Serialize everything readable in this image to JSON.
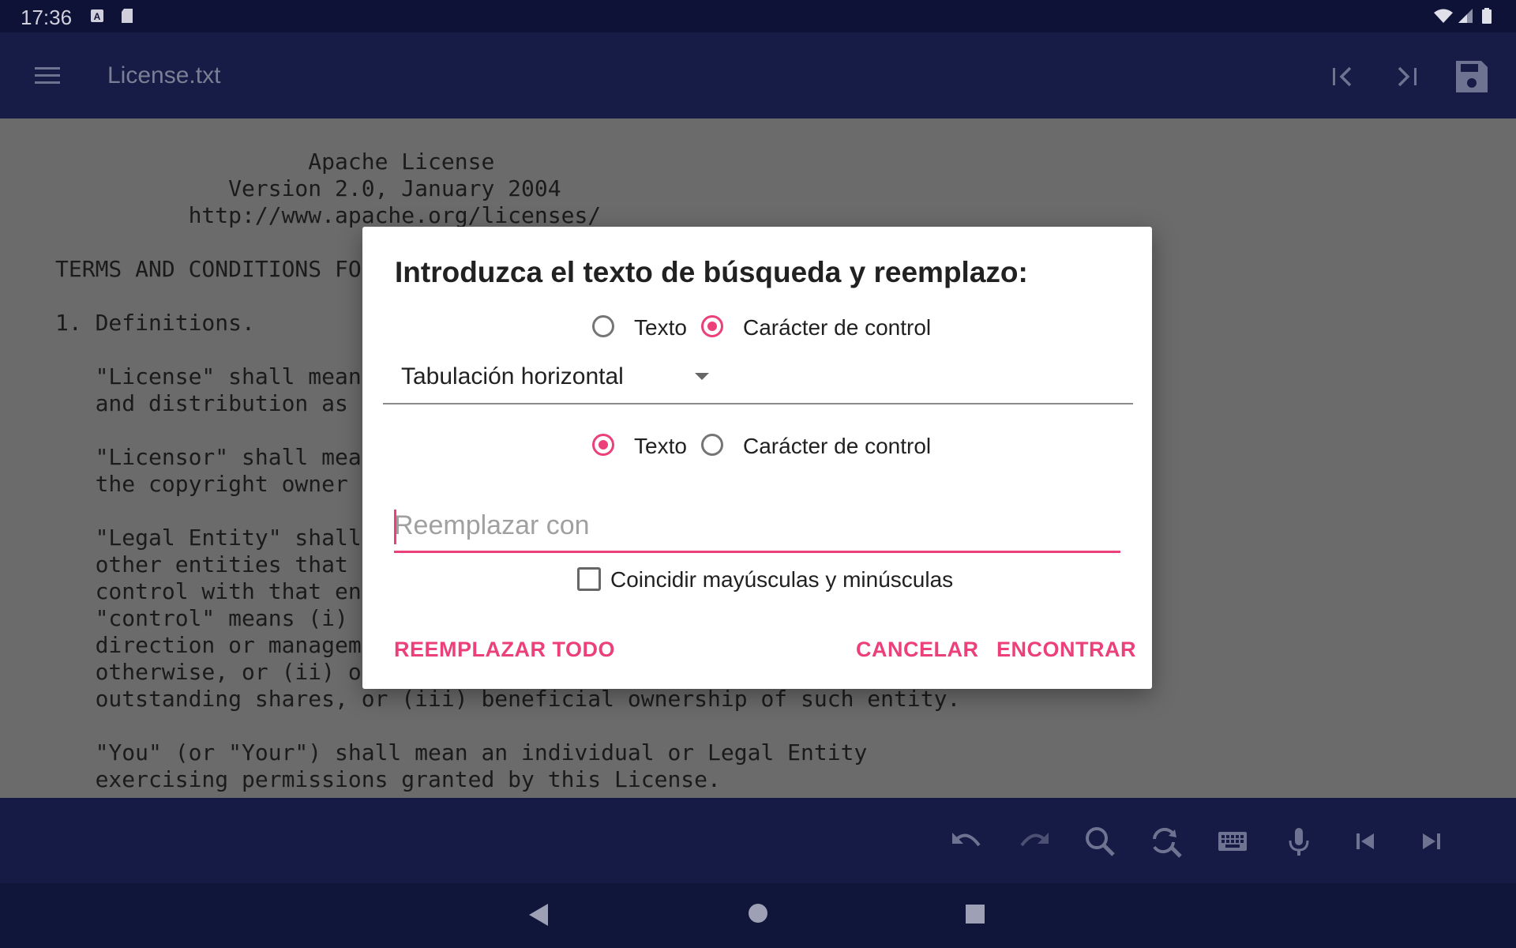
{
  "status_bar": {
    "time": "17:36",
    "icons": [
      "a-notification-icon",
      "sd-card-icon",
      "wifi-icon",
      "signal-icon",
      "battery-icon"
    ]
  },
  "app_bar": {
    "title": "License.txt",
    "icons": [
      "menu-icon",
      "first-page-icon",
      "last-page-icon",
      "save-icon"
    ]
  },
  "editor": {
    "lines": [
      "                   Apache License",
      "             Version 2.0, January 2004",
      "          http://www.apache.org/licenses/",
      "",
      "TERMS AND CONDITIONS FO",
      "",
      "1. Definitions.",
      "",
      "   \"License\" shall mean",
      "   and distribution as",
      "",
      "   \"Licensor\" shall mea",
      "   the copyright owner",
      "",
      "   \"Legal Entity\" shall",
      "   other entities that",
      "   control with that en",
      "   \"control\" means (i)",
      "   direction or managem",
      "   otherwise, or (ii) o",
      "   outstanding shares, or (iii) beneficial ownership of such entity.",
      "",
      "   \"You\" (or \"Your\") shall mean an individual or Legal Entity",
      "   exercising permissions granted by this License."
    ]
  },
  "dialog": {
    "title": "Introduzca el texto de búsqueda y reemplazo:",
    "search_mode": {
      "option_text": "Texto",
      "option_control": "Carácter de control",
      "selected": "control"
    },
    "control_char_select": {
      "value": "Tabulación horizontal"
    },
    "replace_mode": {
      "option_text": "Texto",
      "option_control": "Carácter de control",
      "selected": "text"
    },
    "replace_input": {
      "value": "",
      "placeholder": "Reemplazar con"
    },
    "match_case": {
      "label": "Coincidir mayúsculas y minúsculas",
      "checked": false
    },
    "buttons": {
      "replace_all": "REEMPLAZAR TODO",
      "cancel": "CANCELAR",
      "find": "ENCONTRAR"
    },
    "accent_color": "#ec407a"
  },
  "bottom_toolbar": {
    "icons": [
      "undo-icon",
      "redo-icon",
      "search-icon",
      "find-replace-icon",
      "keyboard-icon",
      "mic-icon",
      "skip-previous-icon",
      "skip-next-icon"
    ]
  },
  "nav_bar": {
    "icons": [
      "back-icon",
      "home-icon",
      "recents-icon"
    ]
  }
}
